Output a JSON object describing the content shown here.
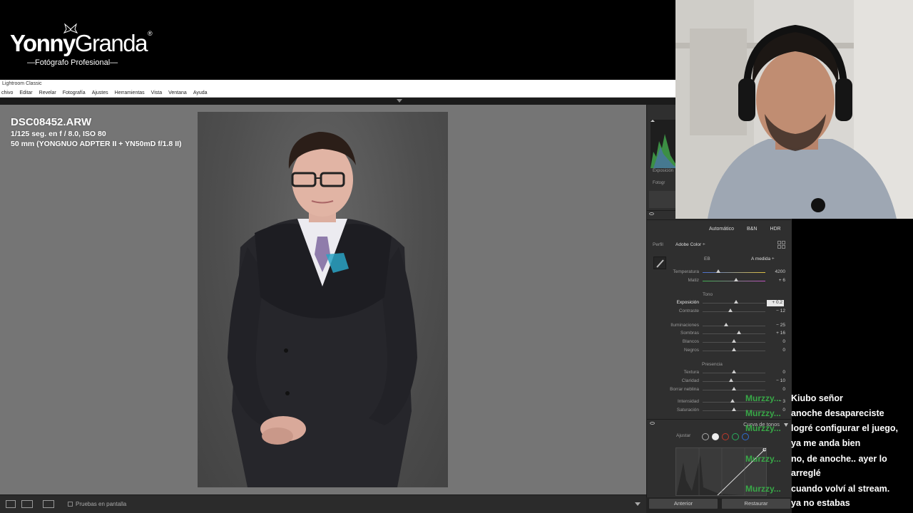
{
  "brand": {
    "name_first": "Yonny",
    "name_second": "Granda",
    "registered": "®",
    "tagline": "—Fotógrafo Profesional—"
  },
  "lightroom": {
    "window_title": "Lightroom Classic",
    "menu": [
      "chivo",
      "Editar",
      "Revelar",
      "Fotografía",
      "Ajustes",
      "Herramientas",
      "Vista",
      "Ventana",
      "Ayuda"
    ],
    "info_overlay": {
      "filename": "DSC08452.ARW",
      "exposure": "1/125 seg. en f / 8.0, ISO 80",
      "lens": "50 mm (YONGNUO ADPTER II + YN50mD f/1.8 II)"
    },
    "toolbar": {
      "proof_label": "Pruebas en pantalla"
    },
    "histogram": {
      "label": "Exposición",
      "photo_label": "Fotogr"
    },
    "basic": {
      "modes": [
        "Automático",
        "B&N",
        "HDR"
      ],
      "profile_label": "Perfil",
      "profile_value": "Adobe Color ÷",
      "wb_label": "EB",
      "wb_value": "A medida ÷",
      "section_tone": "Tono",
      "section_presence": "Presencia",
      "sliders": [
        {
          "name": "temperatura",
          "label": "Temperatura",
          "value": "4200",
          "position": 0.25
        },
        {
          "name": "matiz",
          "label": "Matiz",
          "value": "+ 6",
          "position": 0.53
        },
        {
          "name": "exposicion",
          "label": "Exposición",
          "value": "+ 0.2",
          "position": 0.53,
          "active": true
        },
        {
          "name": "contraste",
          "label": "Contraste",
          "value": "− 12",
          "position": 0.44
        },
        {
          "name": "iluminaciones",
          "label": "Iluminaciones",
          "value": "− 25",
          "position": 0.38
        },
        {
          "name": "sombras",
          "label": "Sombras",
          "value": "+ 16",
          "position": 0.58
        },
        {
          "name": "blancos",
          "label": "Blancos",
          "value": "0",
          "position": 0.5
        },
        {
          "name": "negros",
          "label": "Negros",
          "value": "0",
          "position": 0.5
        },
        {
          "name": "textura",
          "label": "Textura",
          "value": "0",
          "position": 0.5
        },
        {
          "name": "claridad",
          "label": "Claridad",
          "value": "− 10",
          "position": 0.45
        },
        {
          "name": "borrar-neblina",
          "label": "Borrar neblina",
          "value": "0",
          "position": 0.5
        },
        {
          "name": "intensidad",
          "label": "Intensidad",
          "value": "− 3",
          "position": 0.48
        },
        {
          "name": "saturacion",
          "label": "Saturación",
          "value": "0",
          "position": 0.5
        }
      ]
    },
    "tone_curve": {
      "title": "Curva de tonos",
      "adjust_label": "Ajustar"
    },
    "buttons": {
      "previous": "Anterior",
      "reset": "Restaurar"
    }
  },
  "chat": {
    "users": [
      "Murzzy...",
      "Murzzy...",
      "Murzzy...",
      "Murzzy...",
      "Murzzy..."
    ],
    "messages": [
      "Kiubo señor",
      "anoche desapareciste",
      "logré configurar el juego,",
      "ya me anda bien",
      "no, de anoche.. ayer lo",
      "arreglé",
      "cuando volví al stream.",
      "ya no estabas"
    ]
  },
  "colors": {
    "chat_user": "#39b54a",
    "panel_bg": "#2f2f2f",
    "canvas_bg": "#757575"
  }
}
